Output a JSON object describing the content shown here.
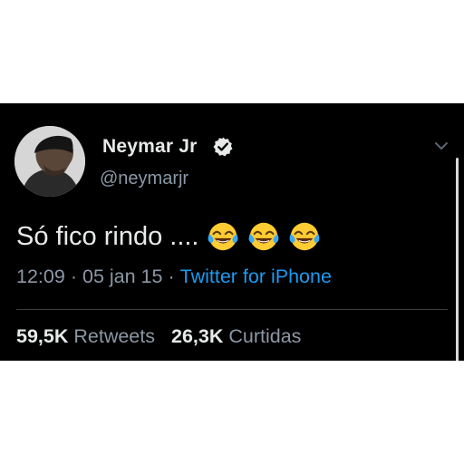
{
  "user": {
    "display_name": "Neymar Jr",
    "handle": "@neymarjr",
    "verified": true
  },
  "tweet": {
    "text": "Só fico rindo ....",
    "emojis": [
      "face-with-tears-of-joy",
      "face-with-tears-of-joy",
      "face-with-tears-of-joy"
    ]
  },
  "meta": {
    "time": "12:09",
    "separator": "·",
    "date": "05 jan 15",
    "source": "Twitter for iPhone"
  },
  "stats": {
    "retweets_count": "59,5K",
    "retweets_label": "Retweets",
    "likes_count": "26,3K",
    "likes_label": "Curtidas"
  },
  "colors": {
    "background": "#000000",
    "text_primary": "#e7e9ea",
    "text_secondary": "#8b98a5",
    "link": "#1d9bf0"
  }
}
